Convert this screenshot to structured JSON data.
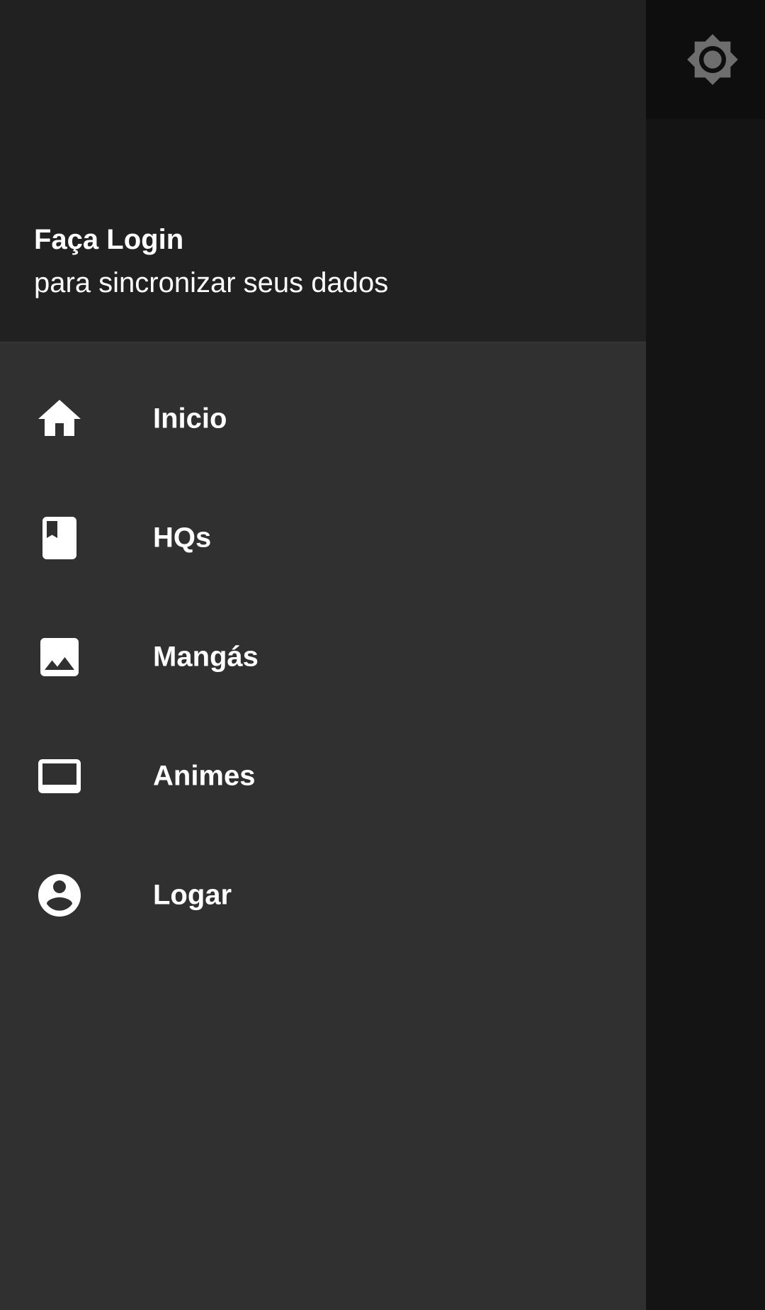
{
  "drawer": {
    "header": {
      "title": "Faça Login",
      "subtitle": "para sincronizar seus dados"
    },
    "items": [
      {
        "label": "Inicio",
        "icon": "home-icon"
      },
      {
        "label": "HQs",
        "icon": "book-icon"
      },
      {
        "label": "Mangás",
        "icon": "image-icon"
      },
      {
        "label": "Animes",
        "icon": "tv-icon"
      },
      {
        "label": "Logar",
        "icon": "account-circle-icon"
      }
    ]
  },
  "app_bar": {
    "action_icon": "brightness-icon"
  },
  "colors": {
    "drawer_bg": "#303030",
    "header_bg": "#212121",
    "scrim_bg": "#141414",
    "text": "#ffffff",
    "toggle_icon": "#6e6e6e"
  }
}
